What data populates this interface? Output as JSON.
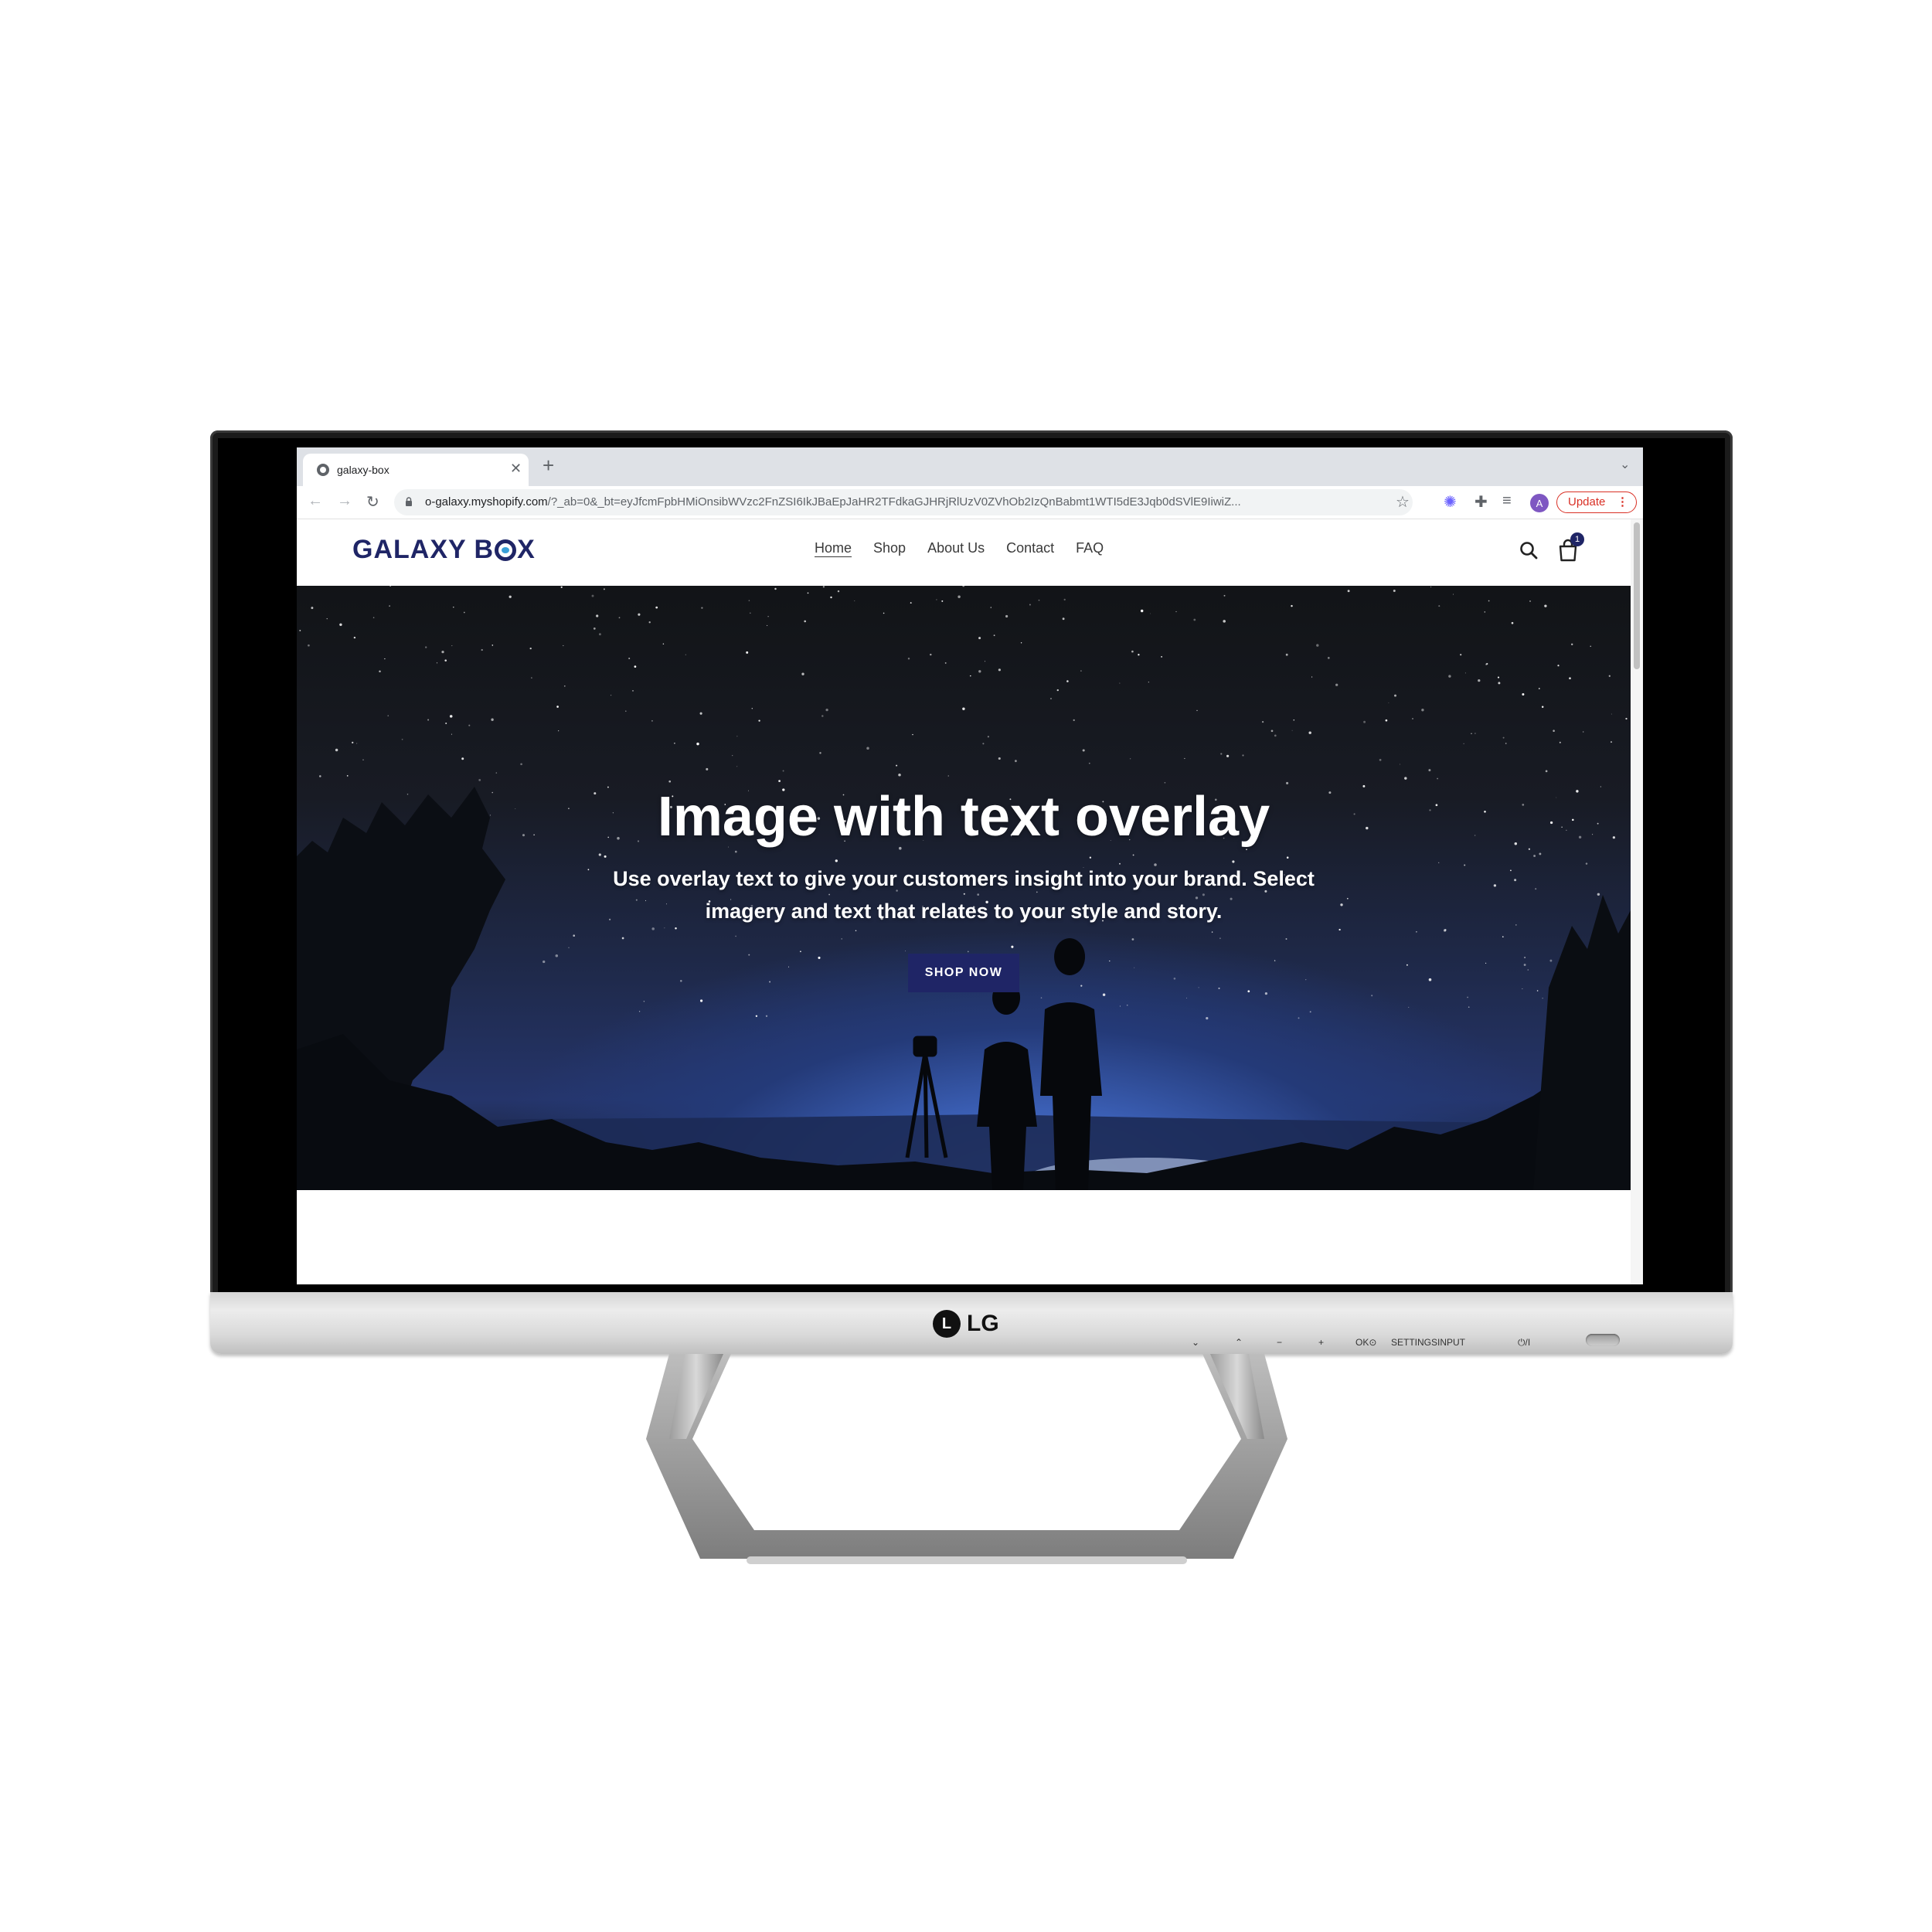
{
  "browser": {
    "tab_title": "galaxy-box",
    "new_tab": "+",
    "url_host": "o-galaxy.myshopify.com",
    "url_rest": "/?_ab=0&_bt=eyJfcmFpbHMiOnsibWVzc2FnZSI6IkJBaEpJaHR2TFdkaGJHRjRlUzV0ZVhOb2IzQnBabmt1WTI5dE3Jqb0dSVlE9IiwiZ...",
    "avatar_letter": "A",
    "update_label": "Update"
  },
  "site": {
    "logo_part1": "GALAXY B",
    "logo_part2": "X",
    "nav": [
      "Home",
      "Shop",
      "About Us",
      "Contact",
      "FAQ"
    ],
    "cart_count": "1"
  },
  "hero": {
    "title": "Image with text overlay",
    "subtitle": "Use overlay text to give your customers insight into your brand. Select imagery and text that relates to your style and story.",
    "button_label": "SHOP NOW"
  },
  "monitor": {
    "brand": "LG",
    "brand_mark": "L",
    "controls": [
      "⌄",
      "⌃",
      "−",
      "+",
      "OK⊙",
      "SETTINGS",
      "INPUT",
      "⏻/I"
    ]
  },
  "colors": {
    "brand_navy": "#1f2566",
    "update_red": "#d93025"
  }
}
